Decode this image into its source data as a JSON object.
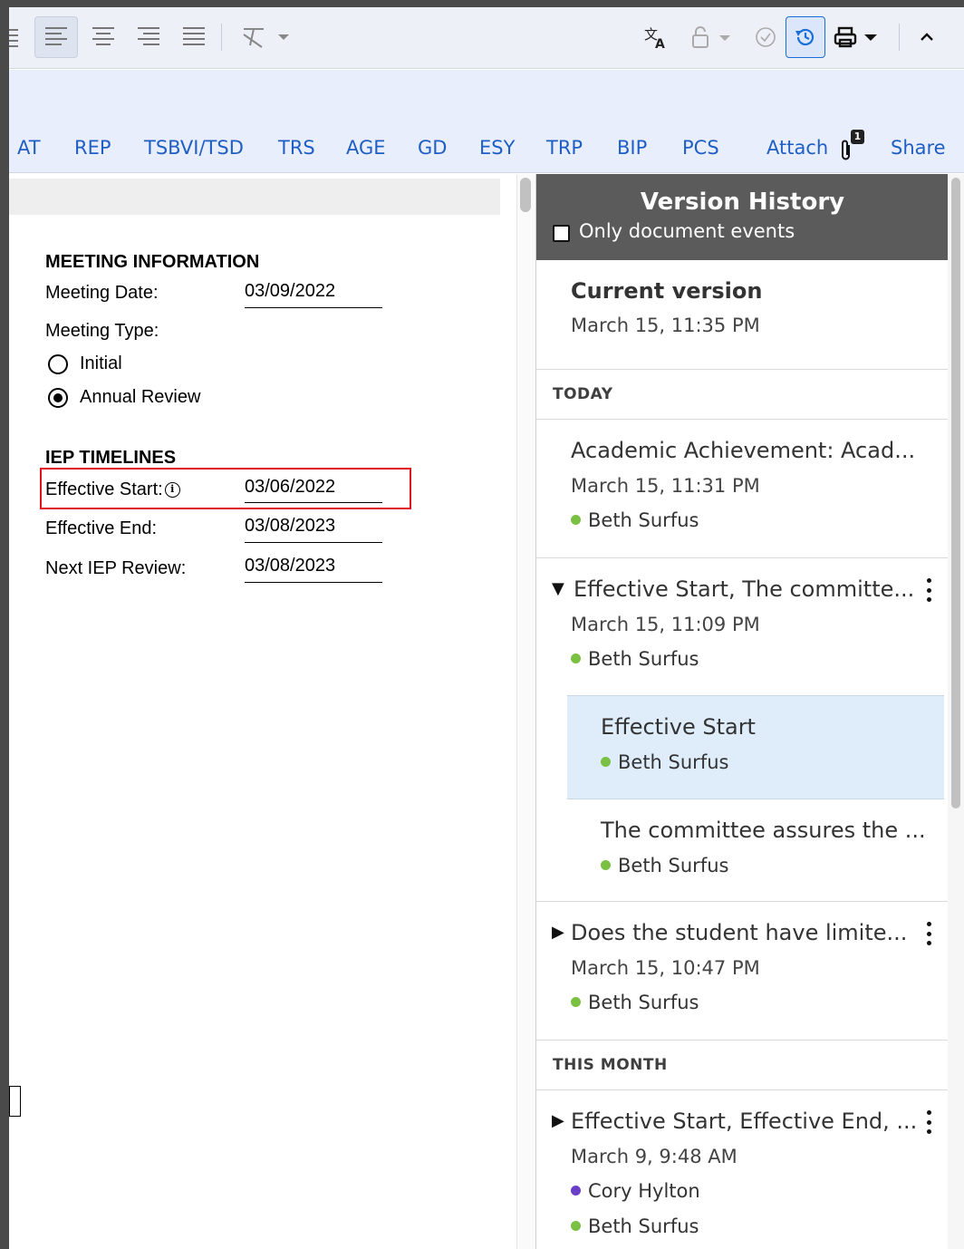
{
  "toolbar": {
    "icons": [
      "align-left-icon",
      "align-center-icon",
      "align-right-icon",
      "align-justify-icon",
      "clear-format-icon",
      "translate-icon",
      "lock-icon",
      "check-circle-icon",
      "history-icon",
      "print-icon",
      "collapse-icon"
    ],
    "colors": {
      "active_history": "#1a6ed8"
    }
  },
  "nav": {
    "tabs": [
      "AT",
      "REP",
      "TSBVI/TSD",
      "TRS",
      "AGE",
      "GD",
      "ESY",
      "TRP",
      "BIP",
      "PCS"
    ],
    "attach_label": "Attach",
    "attach_count": "1",
    "share_label": "Share",
    "link_color": "#1f5fc4"
  },
  "document": {
    "meeting_header": "MEETING INFORMATION",
    "meeting_date_label": "Meeting Date:",
    "meeting_date_value": "03/09/2022",
    "meeting_type_label": "Meeting Type:",
    "option_initial": "Initial",
    "option_annual": "Annual Review",
    "selected_option": "Annual Review",
    "timelines_header": "IEP TIMELINES",
    "effective_start_label": "Effective Start:",
    "effective_start_value": "03/06/2022",
    "effective_end_label": "Effective End:",
    "effective_end_value": "03/08/2023",
    "next_review_label": "Next IEP Review:",
    "next_review_value": "03/08/2023",
    "highlight_color": "#e01020"
  },
  "version_history": {
    "title": "Version History",
    "filter_label": "Only document events",
    "filter_checked": false,
    "current": {
      "title": "Current version",
      "time": "March 15, 11:35 PM"
    },
    "today_label": "TODAY",
    "this_month_label": "THIS MONTH",
    "entries": [
      {
        "title": "Academic Achievement: Acad...",
        "time": "March 15, 11:31 PM",
        "users": [
          "Beth Surfus"
        ]
      },
      {
        "title": "Effective Start, The committe...",
        "time": "March 15, 11:09 PM",
        "users": [
          "Beth Surfus"
        ],
        "expanded": true,
        "children": [
          {
            "title": "Effective Start",
            "user": "Beth Surfus",
            "selected": true
          },
          {
            "title": "The committee assures the ...",
            "user": "Beth Surfus"
          }
        ]
      },
      {
        "title": "Does the student have limite...",
        "time": "March 15, 10:47 PM",
        "users": [
          "Beth Surfus"
        ]
      },
      {
        "title": "Effective Start, Effective End, ...",
        "time": "March 9, 9:48 AM",
        "users": [
          "Cory Hylton",
          "Beth Surfus"
        ]
      }
    ],
    "user_colors": {
      "Beth Surfus": "#7ac143",
      "Cory Hylton": "#6a3fc8"
    }
  }
}
